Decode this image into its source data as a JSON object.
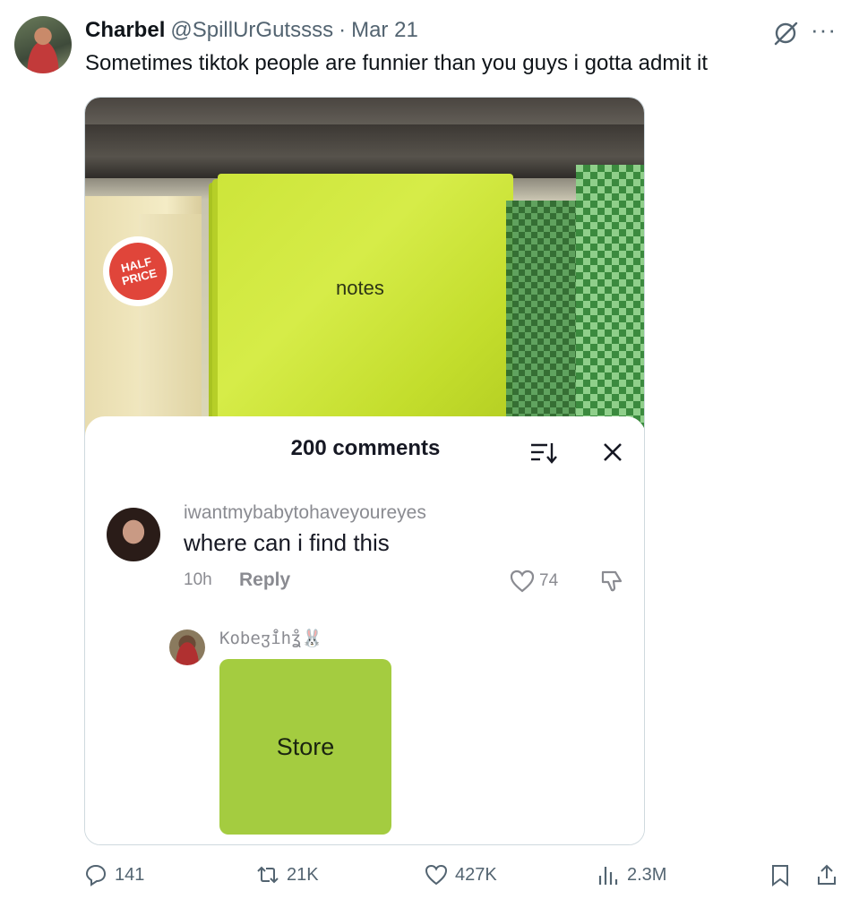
{
  "tweet": {
    "author_name": "Charbel",
    "handle": "@SpillUrGutssss",
    "separator": "·",
    "date": "Mar 21",
    "text": "Sometimes tiktok people are funnier than you guys i gotta admit it"
  },
  "icons": {
    "avatar": "profile-avatar",
    "grok": "grok-icon",
    "more": "more-icon",
    "more_glyph": "···"
  },
  "media": {
    "photo_label": "notes",
    "sticker": [
      "HALF",
      "PRICE"
    ],
    "comments": {
      "title": "200 comments",
      "first": {
        "username": "iwantmybabytohaveyoureyes",
        "text": "where can i find this",
        "time": "10h",
        "reply": "Reply",
        "likes": "74"
      },
      "second": {
        "username": "Kobeჳ̊ihʓ̊🐰",
        "image_text": "Store"
      }
    }
  },
  "actions": {
    "replies": "141",
    "reposts": "21K",
    "likes": "427K",
    "views": "2.3M"
  },
  "colors": {
    "text": "#0f1419",
    "muted": "#536471",
    "store_green": "#a4cc40"
  }
}
